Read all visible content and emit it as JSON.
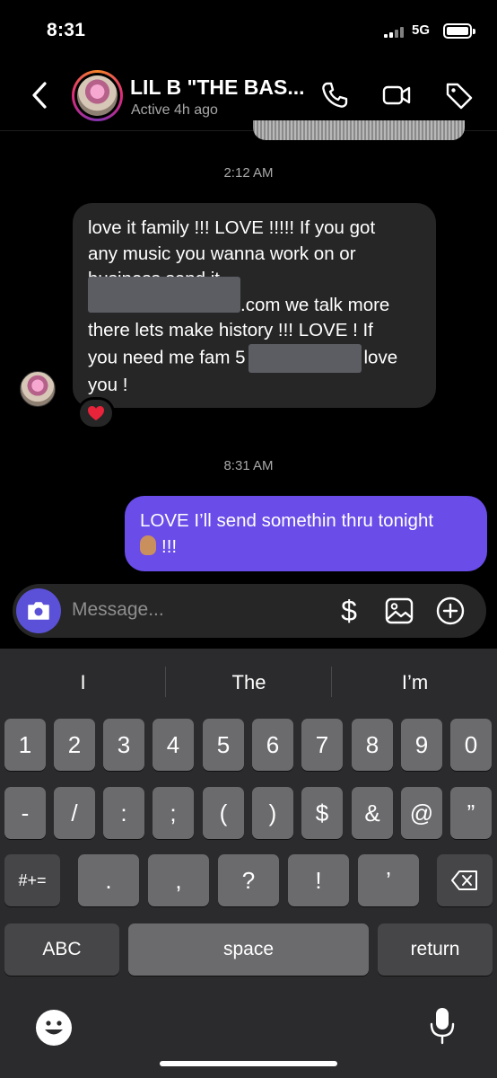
{
  "status_bar": {
    "time": "8:31",
    "network": "5G"
  },
  "header": {
    "name": "LIL B \"THE BAS...",
    "status": "Active 4h ago"
  },
  "chat": {
    "timestamp_1": "2:12 AM",
    "incoming": {
      "line1": "love it family !!! LOVE !!!!! If you got",
      "line2": "any music you wanna work on or",
      "line3": "business send it",
      "line4": ".com we talk more",
      "line5": "there lets make history !!! LOVE ! If",
      "line6a": "you need me fam 5",
      "line6b": "love",
      "line7": "you !",
      "reaction": "heart"
    },
    "timestamp_2": "8:31 AM",
    "outgoing": {
      "line1": "LOVE I’ll send somethin thru tonight",
      "line2": "!!!"
    }
  },
  "composer": {
    "placeholder": "Message...",
    "dollar": "$"
  },
  "keyboard": {
    "suggestions": [
      "I",
      "The",
      "I’m"
    ],
    "row1": [
      "1",
      "2",
      "3",
      "4",
      "5",
      "6",
      "7",
      "8",
      "9",
      "0"
    ],
    "row2": [
      "-",
      "/",
      ":",
      ";",
      "(",
      ")",
      "$",
      "&",
      "@",
      "”"
    ],
    "row3": [
      ".",
      ",",
      "?",
      "!",
      "’"
    ],
    "symbols_key": "#+=",
    "abc_key": "ABC",
    "space_key": "space",
    "return_key": "return"
  },
  "colors": {
    "outgoing_bubble": "#6a4ce8",
    "incoming_bubble": "#262626",
    "camera_button": "#5b51d8"
  }
}
